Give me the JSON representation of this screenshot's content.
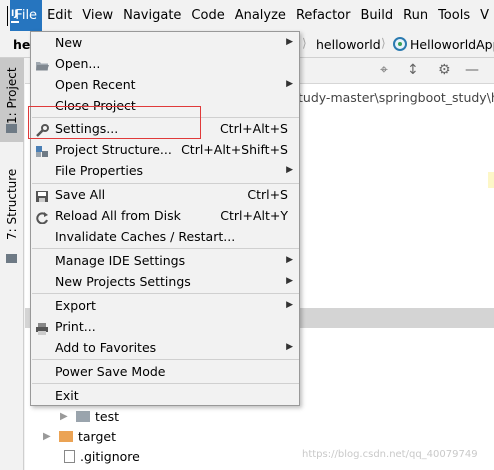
{
  "menubar": {
    "items": [
      "File",
      "Edit",
      "View",
      "Navigate",
      "Code",
      "Analyze",
      "Refactor",
      "Build",
      "Run",
      "Tools",
      "V"
    ]
  },
  "navbar": {
    "project": "hel",
    "crumb1": "helloworld",
    "crumb2": "HelloworldApp"
  },
  "sidebar": {
    "project_tab": "1: Project",
    "structure_tab": "7: Structure"
  },
  "editor": {
    "path": "tudy-master\\springboot_study\\h"
  },
  "tree": [
    {
      "label": "test",
      "type": "folder-grey"
    },
    {
      "label": "target",
      "type": "folder-orange"
    },
    {
      "label": ".gitignore",
      "type": "file"
    }
  ],
  "watermark": "https://blog.csdn.net/qq_40079749",
  "file_menu": {
    "items": [
      {
        "label": "New",
        "shortcut": "",
        "submenu": true,
        "icon": ""
      },
      {
        "label": "Open...",
        "shortcut": "",
        "submenu": false,
        "icon": "folder-open-icon"
      },
      {
        "label": "Open Recent",
        "shortcut": "",
        "submenu": true,
        "icon": ""
      },
      {
        "label": "Close Project",
        "shortcut": "",
        "submenu": false,
        "icon": ""
      },
      {
        "label": "Settings...",
        "shortcut": "Ctrl+Alt+S",
        "submenu": false,
        "icon": "wrench-icon"
      },
      {
        "label": "Project Structure...",
        "shortcut": "Ctrl+Alt+Shift+S",
        "submenu": false,
        "icon": "project-structure-icon"
      },
      {
        "label": "File Properties",
        "shortcut": "",
        "submenu": true,
        "icon": ""
      },
      {
        "label": "Save All",
        "shortcut": "Ctrl+S",
        "submenu": false,
        "icon": "save-icon"
      },
      {
        "label": "Reload All from Disk",
        "shortcut": "Ctrl+Alt+Y",
        "submenu": false,
        "icon": "reload-icon"
      },
      {
        "label": "Invalidate Caches / Restart...",
        "shortcut": "",
        "submenu": false,
        "icon": ""
      },
      {
        "label": "Manage IDE Settings",
        "shortcut": "",
        "submenu": true,
        "icon": ""
      },
      {
        "label": "New Projects Settings",
        "shortcut": "",
        "submenu": true,
        "icon": ""
      },
      {
        "label": "Export",
        "shortcut": "",
        "submenu": true,
        "icon": ""
      },
      {
        "label": "Print...",
        "shortcut": "",
        "submenu": false,
        "icon": "print-icon"
      },
      {
        "label": "Add to Favorites",
        "shortcut": "",
        "submenu": true,
        "icon": ""
      },
      {
        "label": "Power Save Mode",
        "shortcut": "",
        "submenu": false,
        "icon": ""
      },
      {
        "label": "Exit",
        "shortcut": "",
        "submenu": false,
        "icon": ""
      }
    ]
  },
  "colors": {
    "menu_active": "#2675bf",
    "highlight_box": "#e03a3a"
  }
}
